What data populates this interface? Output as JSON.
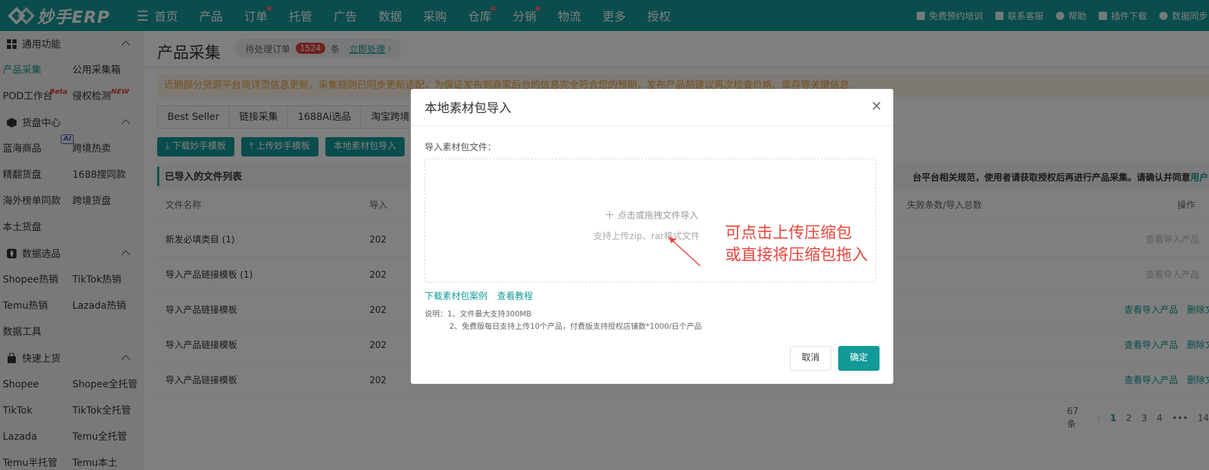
{
  "app": {
    "logo_text": "妙手ERP",
    "brand_color": "#129a99"
  },
  "nav": [
    {
      "label": "首页",
      "dot": false
    },
    {
      "label": "产品",
      "dot": false
    },
    {
      "label": "订单",
      "dot": true
    },
    {
      "label": "托管",
      "dot": false
    },
    {
      "label": "广告",
      "dot": false
    },
    {
      "label": "数据",
      "dot": false
    },
    {
      "label": "采购",
      "dot": false
    },
    {
      "label": "仓库",
      "dot": true
    },
    {
      "label": "分销",
      "dot": true
    },
    {
      "label": "物流",
      "dot": false
    },
    {
      "label": "更多",
      "dot": false
    },
    {
      "label": "授权",
      "dot": false
    }
  ],
  "right_links": [
    "免费预约培训",
    "联系客服",
    "帮助",
    "插件下载",
    "数据同步"
  ],
  "sidebar": {
    "sections": [
      {
        "title": "通用功能",
        "icon": "grid-icon",
        "items": [
          "产品采集",
          "公用采集箱",
          "POD工作台",
          "侵权检测"
        ]
      },
      {
        "title": "货盘中心",
        "icon": "cube-icon",
        "items": [
          "蓝海商品",
          "跨境热卖",
          "精翻货盘",
          "1688搜同款",
          "海外榜单同款",
          "跨境货盘",
          "本土货盘"
        ]
      },
      {
        "title": "数据选品",
        "icon": "flame-icon",
        "items": [
          "Shopee热销",
          "TikTok热销",
          "Temu热销",
          "Lazada热销",
          "数据工具"
        ]
      },
      {
        "title": "快速上货",
        "icon": "bag-icon",
        "items": [
          "Shopee",
          "Shopee全托管",
          "TikTok",
          "TikTok全托管",
          "Lazada",
          "Temu全托管",
          "Temu半托管",
          "Temu本土"
        ]
      }
    ],
    "badges": {
      "beta": "Beta",
      "new": "NEW",
      "ai": "AI"
    }
  },
  "page": {
    "title": "产品采集",
    "pending": {
      "label": "待处理订单",
      "count": "1524",
      "unit": "条",
      "link": "立即处理"
    },
    "notice": "近期部分货源平台商详页信息更新，采集规则已同步更新适配，为保证发布到商家后台的信息完全符合您的预期，发布产品前建议再次检查价格、库存等关键信息",
    "tabs": [
      "Best Seller",
      "链接采集",
      "1688Ai选品",
      "淘宝跨境"
    ],
    "toolbar": [
      "下载妙手模板",
      "上传妙手模板",
      "本地素材包导入"
    ],
    "list_title": "已导入的文件列表",
    "list_notice": "台平台相关规范，使用者请获取授权后再进行产品采集。请确认并同意",
    "list_notice_link": "用户",
    "columns": {
      "name": "文件名称",
      "time": "导入",
      "stat": "失败条数/导入总数",
      "op": "操作"
    },
    "rows": [
      {
        "name": "新发必填类目 (1)",
        "time": "202",
        "ops_enabled": false
      },
      {
        "name": "导入产品链接模板 (1)",
        "time": "202",
        "ops_enabled": false
      },
      {
        "name": "导入产品链接模板",
        "time": "202",
        "ops_enabled": true
      },
      {
        "name": "导入产品链接模板",
        "time": "202",
        "ops_enabled": true
      },
      {
        "name": "导入产品链接模板",
        "time": "202",
        "ops_enabled": true
      }
    ],
    "op_labels": {
      "view": "查看导入产品",
      "delete": "删除文件",
      "delete_short": "删"
    },
    "pager": {
      "total": "67条",
      "pages": [
        "1",
        "2",
        "3",
        "4",
        "•••",
        "14"
      ]
    }
  },
  "modal": {
    "title": "本地素材包导入",
    "field_label": "导入素材包文件：",
    "drop_main": "点击或拖拽文件导入",
    "drop_sub": "支持上传zip、rar格式文件",
    "links": [
      "下载素材包案例",
      "查看教程"
    ],
    "desc_line1": "说明：1、文件最大支持300MB",
    "desc_line2": "2、免费版每日支持上传10个产品，付费版支持授权店铺数*1000/日个产品",
    "cancel": "取消",
    "ok": "确定"
  },
  "annotation": {
    "line1": "可点击上传压缩包",
    "line2": "或直接将压缩包拖入",
    "color": "#e8453c"
  }
}
